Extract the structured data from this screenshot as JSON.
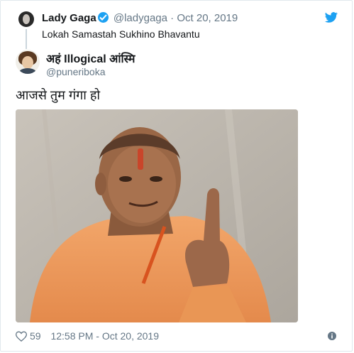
{
  "parent_tweet": {
    "name": "Lady Gaga",
    "handle": "@ladygaga",
    "separator": "·",
    "date": "Oct 20, 2019",
    "text": "Lokah Samastah Sukhino Bhavantu"
  },
  "tweet": {
    "name": "अहं Illogical आंस्मि",
    "handle": "@puneriboka",
    "text": "आजसे तुम गंगा हो",
    "likes": "59",
    "timestamp": "12:58 PM - Oct 20, 2019"
  },
  "icons": {
    "brand": "twitter-bird-icon",
    "verified": "verified-badge-icon",
    "like": "heart-icon",
    "info": "info-icon"
  },
  "colors": {
    "twitter_blue": "#1da1f2",
    "muted_text": "#657786",
    "primary_text": "#14171a",
    "border": "#e1e8ed"
  }
}
